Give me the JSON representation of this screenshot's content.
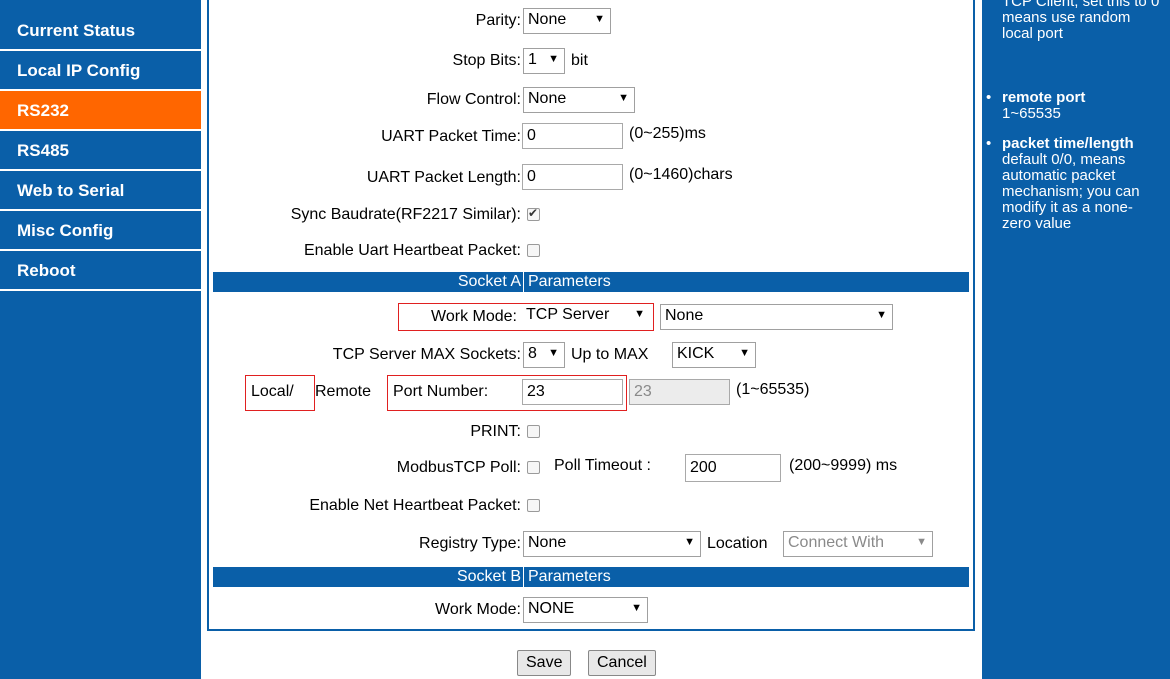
{
  "sidebar": {
    "items": [
      {
        "label": "Current Status"
      },
      {
        "label": "Local IP Config"
      },
      {
        "label": "RS232"
      },
      {
        "label": "RS485"
      },
      {
        "label": "Web to Serial"
      },
      {
        "label": "Misc Config"
      },
      {
        "label": "Reboot"
      }
    ],
    "active_index": 2
  },
  "form": {
    "parity": {
      "label": "Parity:",
      "value": "None"
    },
    "stop_bits": {
      "label": "Stop Bits:",
      "value": "1",
      "unit": "bit"
    },
    "flow_control": {
      "label": "Flow Control:",
      "value": "None"
    },
    "uart_packet_time": {
      "label": "UART Packet Time:",
      "value": "0",
      "hint": "(0~255)ms"
    },
    "uart_packet_length": {
      "label": "UART Packet Length:",
      "value": "0",
      "hint": "(0~1460)chars"
    },
    "sync_baudrate": {
      "label": "Sync Baudrate(RF2217 Similar):",
      "checked": true
    },
    "uart_heartbeat": {
      "label": "Enable Uart Heartbeat Packet:",
      "checked": false
    },
    "socket_a": {
      "left": "Socket A",
      "right": "Parameters"
    },
    "work_mode_a": {
      "label": "Work Mode:",
      "value": "TCP Server",
      "secondary": "None"
    },
    "tcp_max_sockets": {
      "label": "TCP Server MAX Sockets:",
      "value": "8",
      "mid": "Up to MAX",
      "kick": "KICK"
    },
    "port_number": {
      "label_local": "Local/",
      "label_remote": "Remote",
      "label_port": "Port Number:",
      "local": "23",
      "remote": "23",
      "hint": "(1~65535)"
    },
    "print": {
      "label": "PRINT:",
      "checked": false
    },
    "modbus_poll": {
      "label": "ModbusTCP Poll:",
      "checked": false,
      "timeout_label": "Poll Timeout :",
      "timeout": "200",
      "hint": "(200~9999) ms"
    },
    "net_heartbeat": {
      "label": "Enable Net Heartbeat Packet:",
      "checked": false
    },
    "registry_type": {
      "label": "Registry Type:",
      "value": "None",
      "location_label": "Location",
      "location_value": "Connect With"
    },
    "socket_b": {
      "left": "Socket B",
      "right": "Parameters"
    },
    "work_mode_b": {
      "label": "Work Mode:",
      "value": "NONE"
    }
  },
  "buttons": {
    "save": "Save",
    "cancel": "Cancel"
  },
  "help": {
    "top_text": "TCP Client, set this to 0 means use random local port",
    "items": [
      {
        "title": "remote port",
        "body": "1~65535"
      },
      {
        "title": "packet time/length",
        "body": "default 0/0, means automatic packet mechanism; you can modify it as a none-zero value"
      }
    ]
  },
  "colors": {
    "primary": "#0a5fa8",
    "active": "#ff6600",
    "highlight_box": "#e02020"
  }
}
